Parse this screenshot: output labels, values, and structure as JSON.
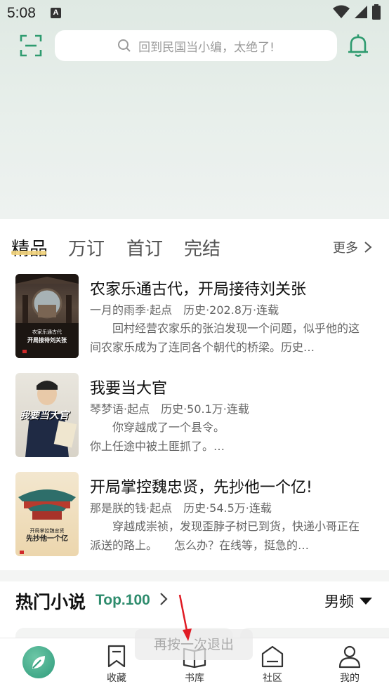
{
  "status_bar": {
    "time": "5:08",
    "notif_letter": "A"
  },
  "header": {
    "search_placeholder": "回到民国当小编，太绝了!"
  },
  "tabs": [
    {
      "label": "精品",
      "active": true
    },
    {
      "label": "万订",
      "active": false
    },
    {
      "label": "首订",
      "active": false
    },
    {
      "label": "完结",
      "active": false
    }
  ],
  "more_label": "更多",
  "books": [
    {
      "title": "农家乐通古代，开局接待刘关张",
      "meta": "一月的雨季·起点　历史·202.8万·连载",
      "desc": "　　回村经营农家乐的张泊发现一个问题，似乎他的这间农家乐成为了连同各个朝代的桥梁。历史…",
      "cover_lines": [
        "农家乐通古代",
        "开局接待刘关张"
      ]
    },
    {
      "title": "我要当大官",
      "meta": "琴梦语·起点　历史·50.1万·连载",
      "desc": "　　你穿越成了一个县令。\n你上任途中被土匪抓了。…",
      "cover_lines": [
        "我要当大官"
      ]
    },
    {
      "title": "开局掌控魏忠贤，先抄他一个亿!",
      "meta": "那是朕的钱·起点　历史·54.5万·连载",
      "desc": "　　穿越成崇祯，发现歪脖子树已到货，快递小哥正在派送的路上。　　怎么办？在线等，挺急的…",
      "cover_lines": [
        "开局掌控魏忠贤",
        "先抄他一个亿"
      ]
    }
  ],
  "hot_section": {
    "title": "热门小说",
    "top_label": "Top.100",
    "gender_label": "男频"
  },
  "toast": "再按一次退出",
  "bottom_nav": [
    {
      "label": "",
      "icon": "home-leaf-icon"
    },
    {
      "label": "收藏",
      "icon": "bookmark-icon"
    },
    {
      "label": "书库",
      "icon": "open-book-icon"
    },
    {
      "label": "社区",
      "icon": "community-icon"
    },
    {
      "label": "我的",
      "icon": "profile-icon"
    }
  ],
  "colors": {
    "accent": "#2e8c6d",
    "tab_underline": "#f1d27a",
    "annotation_arrow": "#e01b24"
  }
}
